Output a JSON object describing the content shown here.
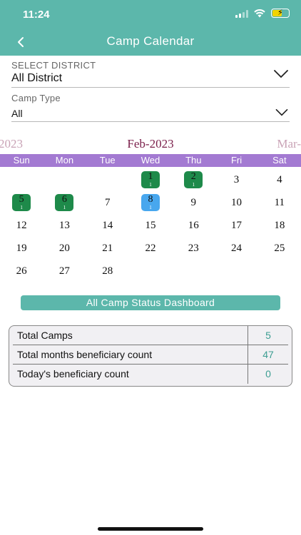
{
  "status_bar": {
    "time": "11:24"
  },
  "header": {
    "title": "Camp Calendar"
  },
  "district": {
    "label": "SELECT DISTRICT",
    "value": "All District"
  },
  "camp_type": {
    "label": "Camp Type",
    "value": "All"
  },
  "calendar": {
    "prev_month": "2023",
    "current_month": "Feb-2023",
    "next_month": "Mar-",
    "weekdays": [
      "Sun",
      "Mon",
      "Tue",
      "Wed",
      "Thu",
      "Fri",
      "Sat"
    ],
    "weeks": [
      [
        {
          "d": ""
        },
        {
          "d": ""
        },
        {
          "d": ""
        },
        {
          "d": "1",
          "count": "1",
          "status": "event"
        },
        {
          "d": "2",
          "count": "1",
          "status": "event"
        },
        {
          "d": "3"
        },
        {
          "d": "4"
        }
      ],
      [
        {
          "d": "5",
          "count": "1",
          "status": "event"
        },
        {
          "d": "6",
          "count": "1",
          "status": "event"
        },
        {
          "d": "7"
        },
        {
          "d": "8",
          "count": "1",
          "status": "today"
        },
        {
          "d": "9"
        },
        {
          "d": "10"
        },
        {
          "d": "11"
        }
      ],
      [
        {
          "d": "12"
        },
        {
          "d": "13"
        },
        {
          "d": "14"
        },
        {
          "d": "15"
        },
        {
          "d": "16"
        },
        {
          "d": "17"
        },
        {
          "d": "18"
        }
      ],
      [
        {
          "d": "19"
        },
        {
          "d": "20"
        },
        {
          "d": "21"
        },
        {
          "d": "22"
        },
        {
          "d": "23"
        },
        {
          "d": "24"
        },
        {
          "d": "25"
        }
      ],
      [
        {
          "d": "26"
        },
        {
          "d": "27"
        },
        {
          "d": "28"
        },
        {
          "d": ""
        },
        {
          "d": ""
        },
        {
          "d": ""
        },
        {
          "d": ""
        }
      ]
    ],
    "colors": {
      "weekbar": "#a37ad2",
      "event": "#1e8a4a",
      "today": "#48a7ee"
    }
  },
  "dashboard": {
    "button_label": "All Camp Status Dashboard",
    "rows": [
      {
        "label": "Total Camps",
        "value": "5"
      },
      {
        "label": "Total months beneficiary count",
        "value": "47"
      },
      {
        "label": "Today's beneficiary count",
        "value": "0"
      }
    ]
  },
  "theme": {
    "accent": "#5cb7ab",
    "value_color": "#3d9e92"
  }
}
